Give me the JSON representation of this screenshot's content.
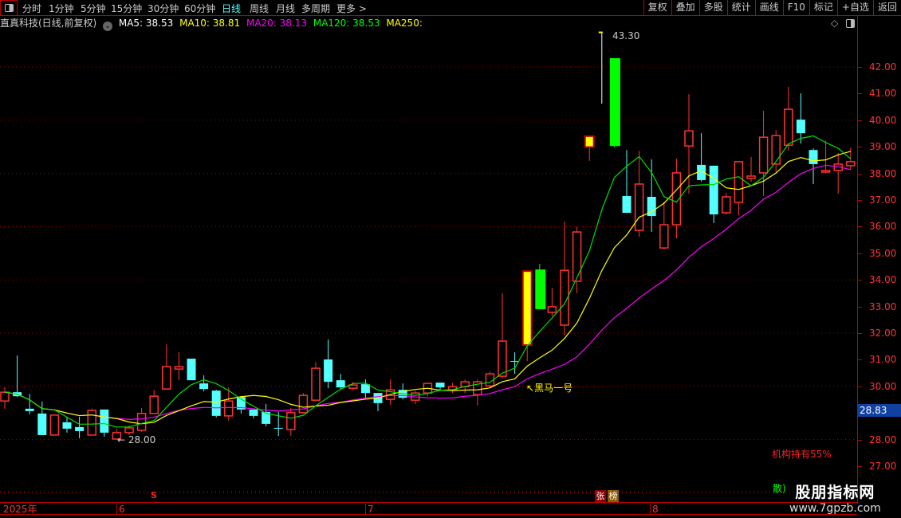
{
  "toolbar": {
    "periods": [
      "分时",
      "1分钟",
      "5分钟",
      "15分钟",
      "30分钟",
      "60分钟",
      "日线",
      "周线",
      "月线",
      "多周期",
      "更多 >"
    ],
    "active_period": "日线",
    "right_buttons": [
      "复权",
      "叠加",
      "多股",
      "统计",
      "画线",
      "F10",
      "标记",
      "+自选",
      "返回"
    ]
  },
  "info": {
    "title": "直真科技(日线,前复权)",
    "ma5": "MA5: 38.53",
    "ma10": "MA10: 38.81",
    "ma20": "MA20: 38.13",
    "ma120": "MA120: 38.53",
    "ma250": "MA250:"
  },
  "colors": {
    "up": "#ff3232",
    "down": "#54ffff",
    "ma5": "#00e000",
    "ma10": "#ffff00",
    "ma20": "#ff00ff",
    "highlight_up": "#ffff00",
    "highlight_down": "#00ff00",
    "axis": "#c00000"
  },
  "annotations": {
    "high_label": "43.30",
    "low_label": "28.00",
    "signal": "黑马一号",
    "holding": "机构持有55%",
    "retail": "散)",
    "marker_s": "S",
    "badge_zhang": "张",
    "badge_bang": "榜",
    "last_price": "28.83"
  },
  "date_axis": [
    "2025年",
    "6",
    "7",
    "8"
  ],
  "watermark": {
    "name": "股朋指标网",
    "url": "www.7gpzb.com"
  },
  "chart_data": {
    "type": "candlestick",
    "ylim": [
      26,
      43.5
    ],
    "y_ticks": [
      "42.00",
      "41.00",
      "40.00",
      "39.00",
      "38.00",
      "37.00",
      "36.00",
      "35.00",
      "34.00",
      "33.00",
      "32.00",
      "31.00",
      "30.00",
      "28.00",
      "27.00"
    ],
    "grid": "dotted every 2.00",
    "ohlc_fields": [
      "open",
      "high",
      "low",
      "close",
      "style"
    ],
    "candles": [
      [
        29.45,
        29.96,
        29.16,
        29.78
      ],
      [
        29.78,
        31.16,
        29.6,
        29.63
      ],
      [
        29.16,
        29.72,
        28.95,
        29.07
      ],
      [
        28.98,
        29.43,
        28.17,
        28.17
      ],
      [
        28.17,
        28.92,
        28.17,
        28.92
      ],
      [
        28.65,
        28.86,
        28.26,
        28.41
      ],
      [
        28.47,
        28.86,
        28.05,
        28.32
      ],
      [
        28.17,
        29.16,
        28.17,
        29.1
      ],
      [
        29.13,
        29.13,
        28.11,
        28.26
      ],
      [
        28.02,
        28.41,
        28.0,
        28.26
      ],
      [
        28.26,
        28.53,
        28.17,
        28.44
      ],
      [
        28.35,
        29.19,
        28.29,
        28.98
      ],
      [
        28.98,
        29.87,
        28.98,
        29.63
      ],
      [
        29.9,
        31.58,
        29.9,
        30.74
      ],
      [
        30.65,
        31.28,
        30.23,
        30.74
      ],
      [
        31.04,
        31.04,
        30.23,
        30.23
      ],
      [
        30.11,
        30.41,
        29.81,
        29.9
      ],
      [
        29.84,
        29.87,
        28.83,
        28.89
      ],
      [
        28.89,
        29.96,
        28.71,
        29.45
      ],
      [
        29.6,
        29.6,
        28.98,
        29.13
      ],
      [
        29.13,
        29.13,
        28.8,
        28.89
      ],
      [
        29.04,
        29.34,
        28.5,
        28.59
      ],
      [
        28.44,
        29.04,
        28.14,
        28.41
      ],
      [
        28.38,
        29.19,
        28.14,
        29.01
      ],
      [
        29.01,
        29.75,
        28.98,
        29.66
      ],
      [
        29.48,
        30.92,
        29.48,
        30.68
      ],
      [
        31.01,
        31.76,
        29.93,
        30.17
      ],
      [
        30.23,
        30.47,
        29.9,
        29.96
      ],
      [
        29.93,
        30.17,
        29.84,
        30.05
      ],
      [
        30.08,
        30.26,
        29.54,
        29.75
      ],
      [
        29.75,
        29.75,
        29.07,
        29.37
      ],
      [
        29.51,
        30.26,
        29.31,
        29.87
      ],
      [
        29.87,
        30.11,
        29.51,
        29.57
      ],
      [
        29.48,
        29.84,
        29.33,
        29.75
      ],
      [
        29.75,
        30.11,
        29.63,
        30.11
      ],
      [
        30.14,
        30.14,
        29.84,
        29.96
      ],
      [
        29.87,
        30.14,
        29.75,
        29.99
      ],
      [
        29.99,
        30.26,
        29.75,
        30.17
      ],
      [
        29.69,
        30.26,
        29.28,
        30.17
      ],
      [
        30.02,
        30.56,
        29.93,
        30.47
      ],
      [
        30.38,
        33.5,
        30.3,
        31.7
      ],
      [
        30.95,
        31.28,
        30.47,
        30.92
      ],
      [
        31.55,
        34.33,
        30.95,
        34.33,
        "hl"
      ],
      [
        34.39,
        34.6,
        32.9,
        32.9,
        "hl"
      ],
      [
        32.78,
        33.7,
        32.63,
        32.99
      ],
      [
        32.3,
        36.19,
        31.91,
        34.36
      ],
      [
        33.95,
        36.0,
        33.5,
        35.8
      ],
      [
        38.99,
        39.4,
        38.47,
        39.4,
        "hl"
      ],
      [
        40.62,
        43.3,
        40.62,
        40.62,
        "line"
      ],
      [
        42.33,
        42.33,
        38.97,
        39.03,
        "hl"
      ],
      [
        37.15,
        38.88,
        36.52,
        36.52
      ],
      [
        35.86,
        38.85,
        35.62,
        37.6
      ],
      [
        37.12,
        38.53,
        35.8,
        36.4
      ],
      [
        35.2,
        36.94,
        35.14,
        36.07
      ],
      [
        36.07,
        38.56,
        35.56,
        38.02
      ],
      [
        39.03,
        40.98,
        37.24,
        39.6
      ],
      [
        38.32,
        39.51,
        37.69,
        37.75
      ],
      [
        38.29,
        38.29,
        36.13,
        36.46
      ],
      [
        36.52,
        37.27,
        36.46,
        37.12
      ],
      [
        36.91,
        38.44,
        36.43,
        38.44
      ],
      [
        37.81,
        38.62,
        37.69,
        37.9
      ],
      [
        38.02,
        40.35,
        37.15,
        39.36
      ],
      [
        38.35,
        39.63,
        38.05,
        39.42
      ],
      [
        39.06,
        41.25,
        38.85,
        40.41
      ],
      [
        40.02,
        41.01,
        39.12,
        39.51
      ],
      [
        38.88,
        38.94,
        37.6,
        38.35
      ],
      [
        38.05,
        39.24,
        38.02,
        38.11
      ],
      [
        38.11,
        38.77,
        37.24,
        38.35
      ],
      [
        38.29,
        38.97,
        38.14,
        38.44
      ]
    ],
    "moving_averages": [
      "MA5",
      "MA10",
      "MA20"
    ]
  }
}
